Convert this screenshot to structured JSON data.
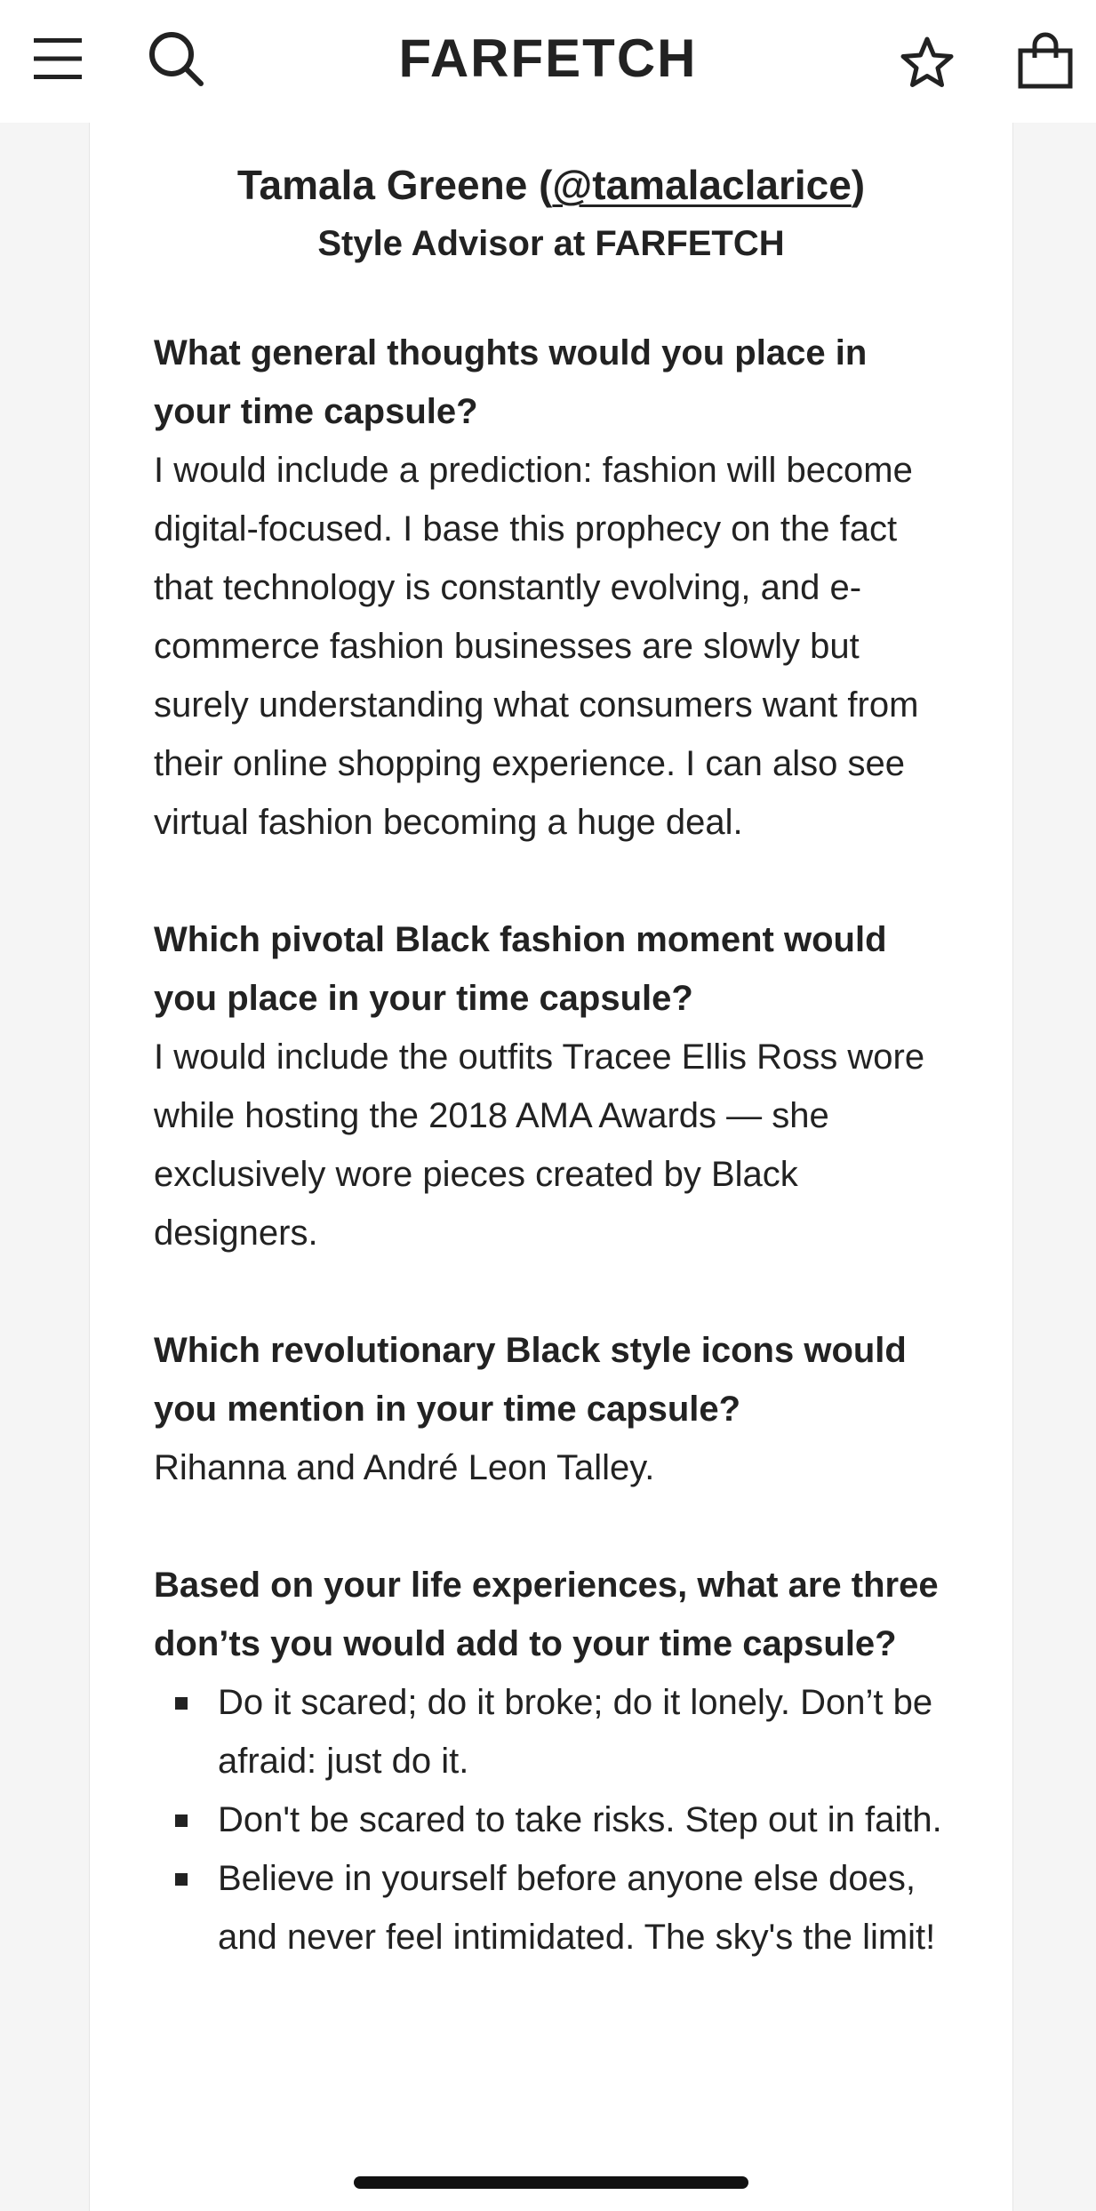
{
  "header": {
    "logo": "FARFETCH",
    "icons": {
      "menu": "hamburger-menu-icon",
      "search": "search-icon",
      "wishlist": "star-icon",
      "bag": "shopping-bag-icon"
    }
  },
  "author": {
    "name_prefix": "Tamala Greene (",
    "handle": "@tamalaclarice",
    "name_suffix": ")",
    "role": "Style Advisor at FARFETCH"
  },
  "qa": [
    {
      "question": "What general thoughts would you place in your time capsule?",
      "answer": "I would include a prediction: fashion will become digital-focused. I base this prophecy on the fact that technology is constantly evolving, and e-commerce fashion businesses are slowly but surely understanding what consumers want from their online shopping experience. I can also see virtual fashion becoming a huge deal."
    },
    {
      "question": "Which pivotal Black fashion moment would you place in your time capsule?",
      "answer": "I would include the outfits Tracee Ellis Ross wore while hosting the 2018 AMA Awards — she exclusively wore pieces created by Black designers."
    },
    {
      "question": "Which revolutionary Black style icons would you mention in your time capsule?",
      "answer": "Rihanna and André Leon Talley."
    },
    {
      "question": "Based on your life experiences, what are three don’ts you would add to your time capsule?",
      "list": [
        "Do it scared; do it broke; do it lonely. Don’t be afraid: just do it.",
        "Don't be scared to take risks. Step out in faith.",
        "Believe in yourself before anyone else does, and never feel intimidated. The sky's the limit!"
      ]
    }
  ]
}
